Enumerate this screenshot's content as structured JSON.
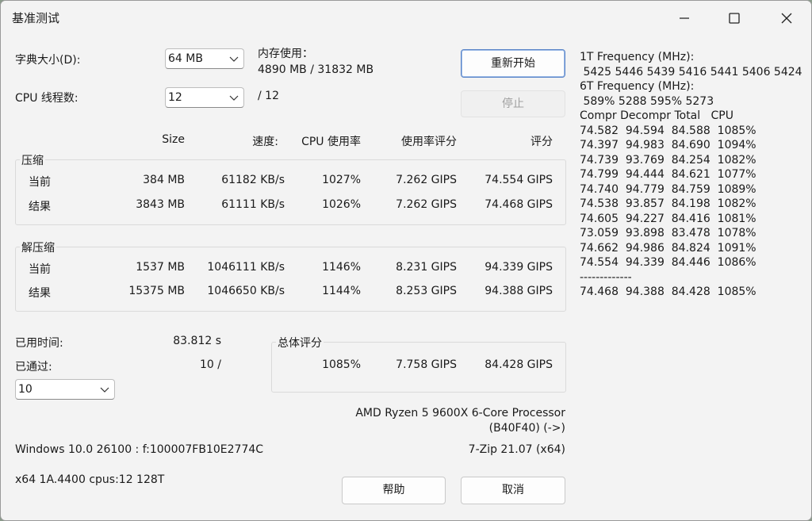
{
  "window": {
    "title": "基准测试"
  },
  "settings": {
    "dict_label": "字典大小(D):",
    "dict_value": "64 MB",
    "mem_label": "内存使用：",
    "mem_value": "4890 MB / 31832 MB",
    "threads_label": "CPU 线程数:",
    "threads_value": "12",
    "threads_total": "/ 12"
  },
  "buttons": {
    "restart": "重新开始",
    "stop": "停止",
    "help": "帮助",
    "cancel": "取消"
  },
  "table": {
    "headers": [
      "Size",
      "速度:",
      "CPU 使用率",
      "使用率评分",
      "评分"
    ],
    "compress": {
      "label": "压缩",
      "rows": [
        {
          "name": "当前",
          "size": "384 MB",
          "speed": "61182 KB/s",
          "cpu": "1027%",
          "rating_usage": "7.262 GIPS",
          "rating": "74.554 GIPS"
        },
        {
          "name": "结果",
          "size": "3843 MB",
          "speed": "61111 KB/s",
          "cpu": "1026%",
          "rating_usage": "7.262 GIPS",
          "rating": "74.468 GIPS"
        }
      ]
    },
    "decompress": {
      "label": "解压缩",
      "rows": [
        {
          "name": "当前",
          "size": "1537 MB",
          "speed": "1046111 KB/s",
          "cpu": "1146%",
          "rating_usage": "8.231 GIPS",
          "rating": "94.339 GIPS"
        },
        {
          "name": "结果",
          "size": "15375 MB",
          "speed": "1046650 KB/s",
          "cpu": "1144%",
          "rating_usage": "8.253 GIPS",
          "rating": "94.388 GIPS"
        }
      ]
    }
  },
  "stats": {
    "elapsed_label": "已用时间:",
    "elapsed_value": "83.812 s",
    "passes_label": "已通过:",
    "passes_value": "10 /",
    "passes_select": "10"
  },
  "total": {
    "label": "总体评分",
    "cpu": "1085%",
    "rating_usage": "7.758 GIPS",
    "rating": "84.428 GIPS"
  },
  "system": {
    "cpu_name": "AMD Ryzen 5 9600X 6-Core Processor",
    "cpu_id": "(B40F40) (->)",
    "os": "Windows 10.0 26100 :  f:100007FB10E2774C",
    "version": "7-Zip 21.07 (x64)",
    "arch": "x64 1A.4400 cpus:12 128T"
  },
  "log": [
    "1T Frequency (MHz):",
    " 5425 5446 5439 5416 5441 5406 5424",
    "6T Frequency (MHz):",
    " 589% 5288 595% 5273",
    "Compr Decompr Total   CPU",
    "74.582  94.594  84.588  1085%",
    "74.397  94.983  84.690  1094%",
    "74.739  93.769  84.254  1082%",
    "74.799  94.444  84.621  1077%",
    "74.740  94.779  84.759  1089%",
    "74.538  93.857  84.198  1082%",
    "74.605  94.227  84.416  1081%",
    "73.059  93.898  83.478  1078%",
    "74.662  94.986  84.824  1091%",
    "74.554  94.339  84.446  1086%",
    "-------------",
    "74.468  94.388  84.428  1085%"
  ]
}
